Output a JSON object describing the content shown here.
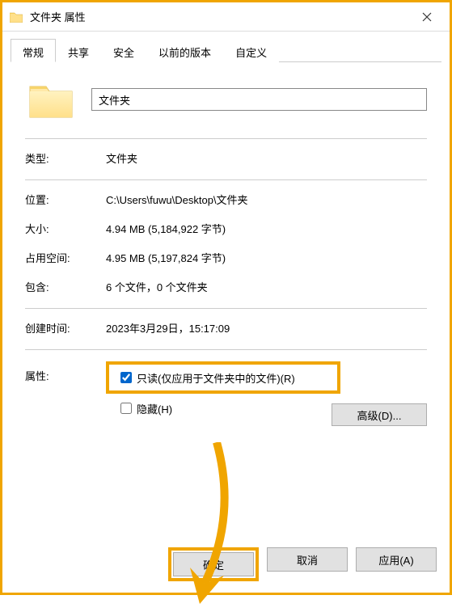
{
  "titlebar": {
    "title": "文件夹 属性"
  },
  "tabs": {
    "t0": "常规",
    "t1": "共享",
    "t2": "安全",
    "t3": "以前的版本",
    "t4": "自定义"
  },
  "name_value": "文件夹",
  "labels": {
    "type": "类型:",
    "location": "位置:",
    "size": "大小:",
    "size_on_disk": "占用空间:",
    "contains": "包含:",
    "created": "创建时间:",
    "attributes": "属性:"
  },
  "values": {
    "type": "文件夹",
    "location": "C:\\Users\\fuwu\\Desktop\\文件夹",
    "size": "4.94 MB (5,184,922 字节)",
    "size_on_disk": "4.95 MB (5,197,824 字节)",
    "contains": "6 个文件，0 个文件夹",
    "created": "2023年3月29日，15:17:09"
  },
  "attributes": {
    "readonly_label": "只读(仅应用于文件夹中的文件)(R)",
    "hidden_label": "隐藏(H)",
    "advanced_label": "高级(D)..."
  },
  "buttons": {
    "ok": "确定",
    "cancel": "取消",
    "apply": "应用(A)"
  }
}
